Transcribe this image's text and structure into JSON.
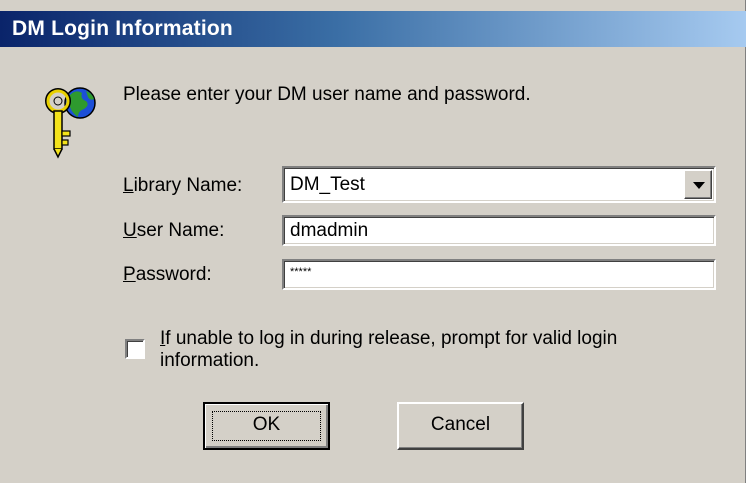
{
  "window": {
    "title": "DM Login Information"
  },
  "prompt": "Please enter your DM user name and password.",
  "icon": "key-globe-icon",
  "library": {
    "label_hotkey": "L",
    "label_rest": "ibrary Name:",
    "value": "DM_Test"
  },
  "user": {
    "label_hotkey": "U",
    "label_rest": "ser Name:",
    "value": "dmadmin"
  },
  "password": {
    "label_hotkey": "P",
    "label_rest": "assword:",
    "value": "*****"
  },
  "checkbox": {
    "hotkey": "I",
    "label_rest": "f unable to log in during release, prompt for valid login information.",
    "checked": false
  },
  "buttons": {
    "ok": "OK",
    "cancel": "Cancel"
  }
}
